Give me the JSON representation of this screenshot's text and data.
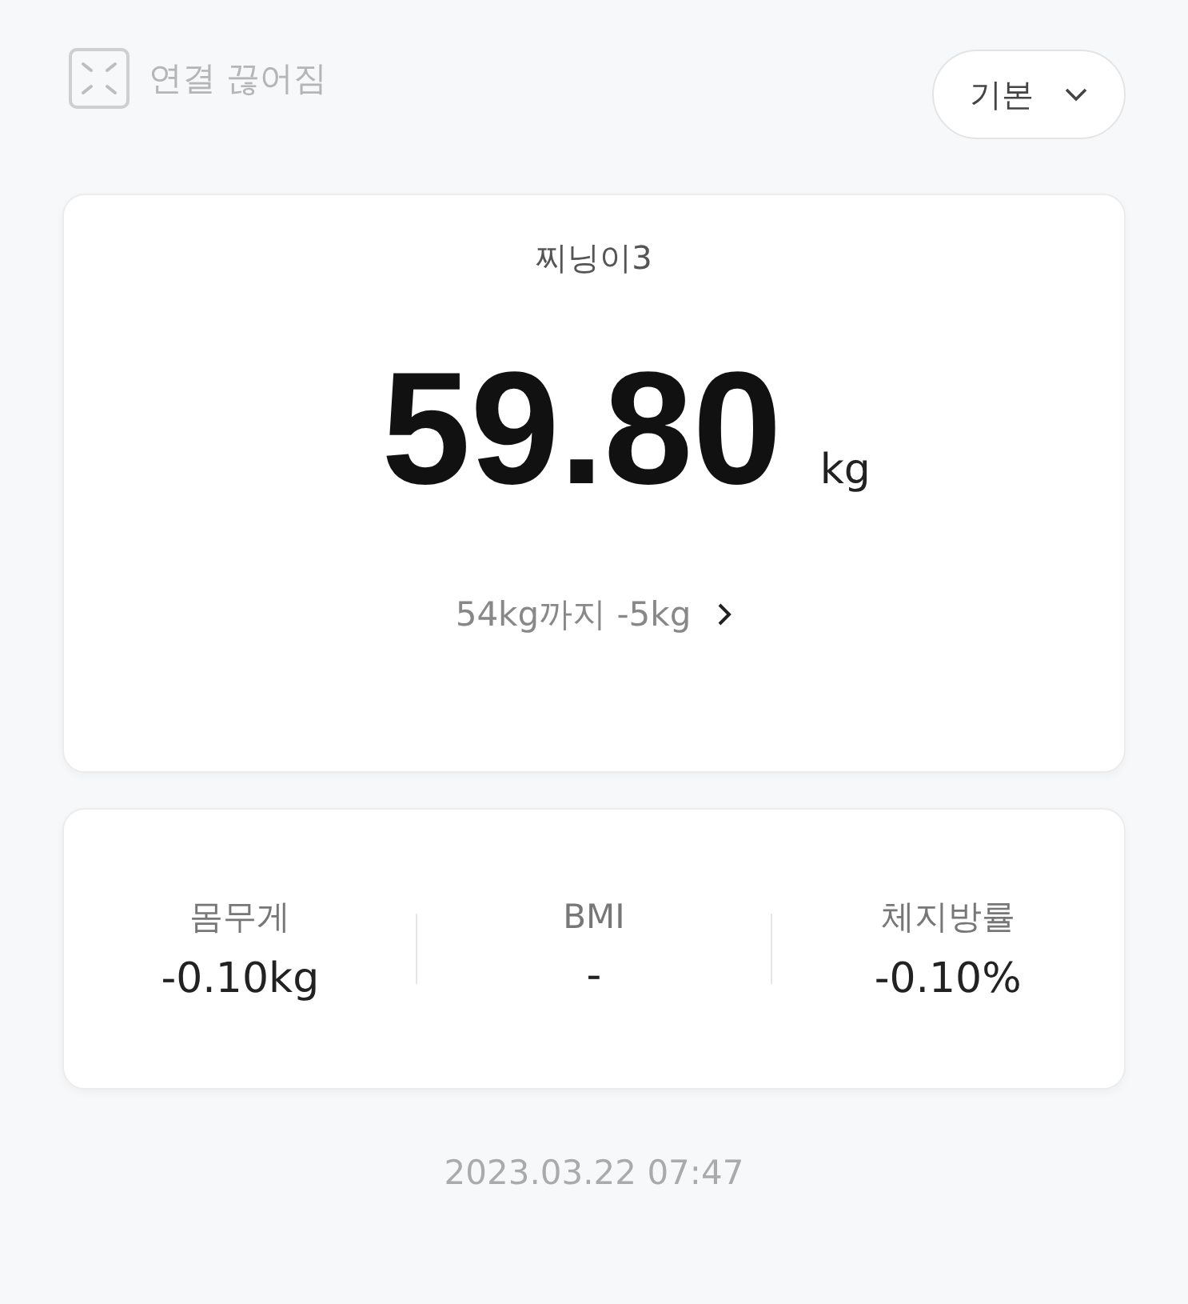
{
  "connection": {
    "status": "연결 끊어짐"
  },
  "mode_button": {
    "label": "기본"
  },
  "weight_card": {
    "profile": "찌닝이3",
    "weight": "59.80",
    "unit": "kg",
    "goal": "54kg까지 -5kg"
  },
  "stats": [
    {
      "label": "몸무게",
      "value": "-0.10kg"
    },
    {
      "label": "BMI",
      "value": "-"
    },
    {
      "label": "체지방률",
      "value": "-0.10%"
    }
  ],
  "timestamp": "2023.03.22 07:47"
}
